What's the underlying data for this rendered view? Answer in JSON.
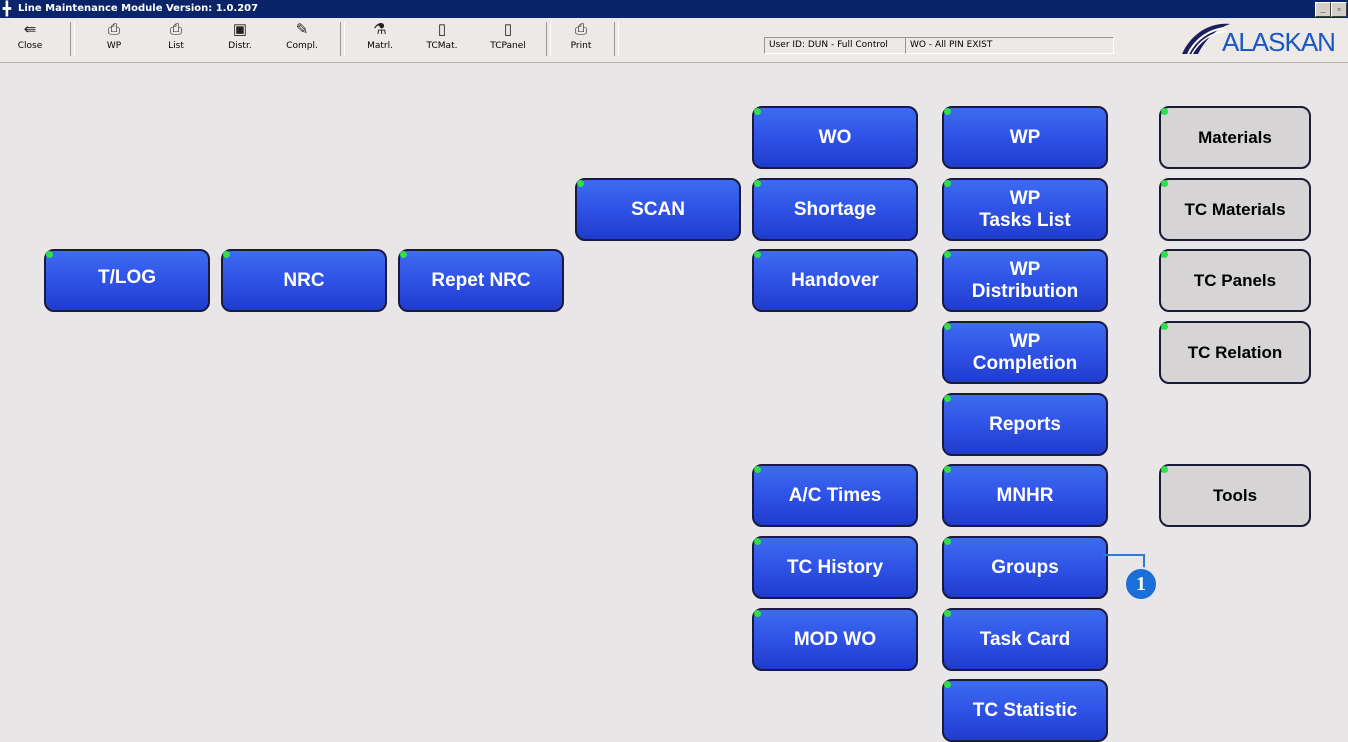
{
  "window": {
    "title": "Line Maintenance Module  Version: 1.0.207",
    "minimize_label": "_",
    "restore_label": "▫"
  },
  "toolbar": {
    "buttons": [
      {
        "label": "Close",
        "icon": "door-exit-icon"
      },
      {
        "label": "WP",
        "icon": "printer-icon"
      },
      {
        "label": "List",
        "icon": "printer-icon"
      },
      {
        "label": "Distr.",
        "icon": "distribute-icon"
      },
      {
        "label": "Compl.",
        "icon": "complete-icon"
      },
      {
        "label": "Matrl.",
        "icon": "flask-icon"
      },
      {
        "label": "TCMat.",
        "icon": "document-icon"
      },
      {
        "label": "TCPanel",
        "icon": "document-icon"
      },
      {
        "label": "Print",
        "icon": "printer-icon"
      }
    ],
    "user_status": "User ID: DUN - Full Control",
    "wo_status": "WO - All  PIN EXIST"
  },
  "logo": {
    "text": "ALASKAN"
  },
  "menu": {
    "tlog": "T/LOG",
    "nrc": "NRC",
    "repet_nrc": "Repet NRC",
    "scan": "SCAN",
    "wo": "WO",
    "shortage": "Shortage",
    "handover": "Handover",
    "ac_times": "A/C Times",
    "tc_history": "TC History",
    "mod_wo": "MOD WO",
    "wp": "WP",
    "wp_tasks_list": [
      "WP",
      "Tasks List"
    ],
    "wp_distribution": [
      "WP",
      "Distribution"
    ],
    "wp_completion": [
      "WP",
      "Completion"
    ],
    "reports": "Reports",
    "mnhr": "MNHR",
    "groups": "Groups",
    "task_card": "Task Card",
    "tc_statistic": "TC Statistic",
    "materials": "Materials",
    "tc_materials": "TC Materials",
    "tc_panels": "TC Panels",
    "tc_relation": "TC Relation",
    "tools": "Tools"
  },
  "callout": {
    "number": "1"
  },
  "colors": {
    "title_bar": "#0a246a",
    "button_blue": "#2f52e6",
    "button_gray": "#d6d4d4",
    "indicator_green": "#2ee04a",
    "callout_blue": "#1b6fd8"
  }
}
